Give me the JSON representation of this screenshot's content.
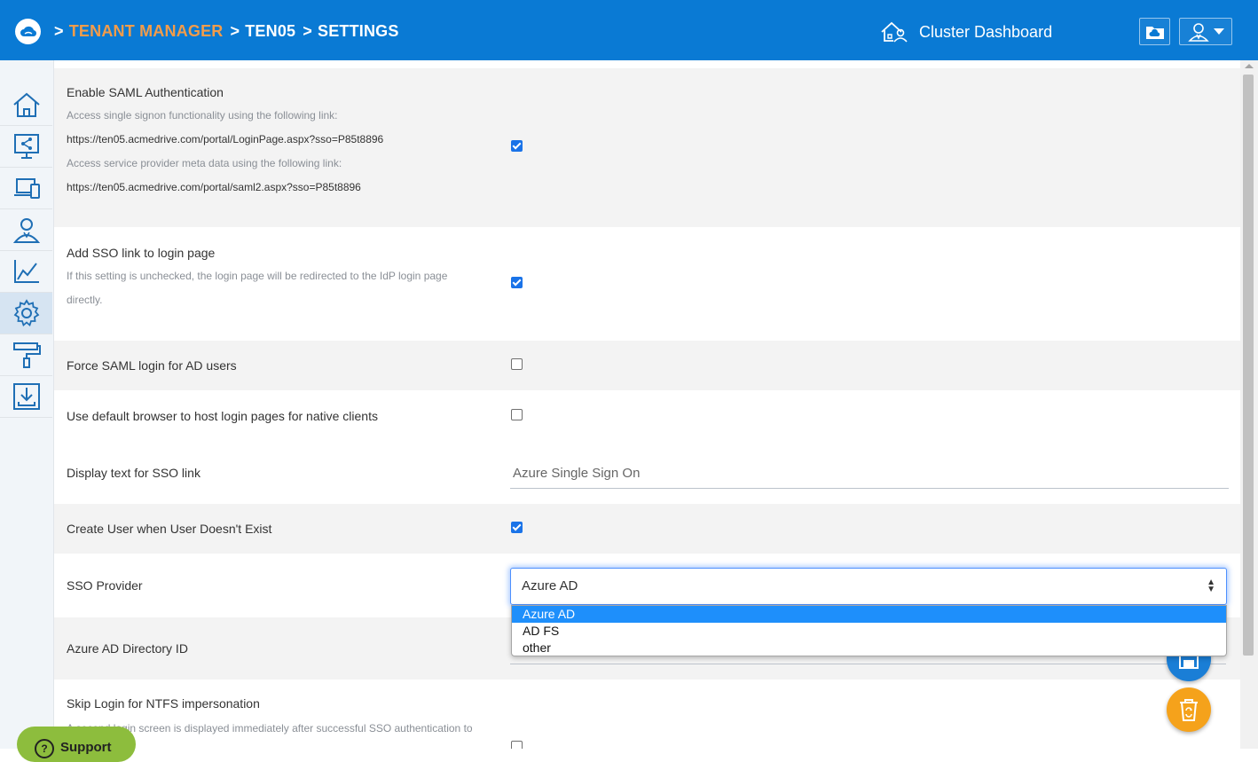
{
  "header": {
    "breadcrumb": [
      {
        "label": "TENANT MANAGER",
        "active": true
      },
      {
        "label": "TEN05",
        "active": false
      },
      {
        "label": "SETTINGS",
        "active": false
      }
    ],
    "breadcrumb_separator": ">",
    "cluster_label": "Cluster Dashboard",
    "accent_color": "#0a7ad4",
    "active_crumb_color": "#f39c4a"
  },
  "sidebar": {
    "items": [
      {
        "icon": "home-icon"
      },
      {
        "icon": "share-screen-icon"
      },
      {
        "icon": "devices-icon"
      },
      {
        "icon": "user-admin-icon"
      },
      {
        "icon": "chart-icon"
      },
      {
        "icon": "gear-icon",
        "active": true
      },
      {
        "icon": "paint-roller-icon"
      },
      {
        "icon": "download-icon"
      }
    ]
  },
  "settings": {
    "saml": {
      "label": "Enable SAML Authentication",
      "desc1": "Access single signon functionality using the following link:",
      "link1": "https://ten05.acmedrive.com/portal/LoginPage.aspx?sso=P85t8896",
      "desc2": "Access service provider meta data using the following link:",
      "link2": "https://ten05.acmedrive.com/portal/saml2.aspx?sso=P85t8896",
      "checked": true
    },
    "sso_link": {
      "label": "Add SSO link to login page",
      "desc": "If this setting is unchecked, the login page will be redirected to the IdP login page directly.",
      "checked": true
    },
    "force_saml": {
      "label": "Force SAML login for AD users",
      "checked": false
    },
    "default_browser": {
      "label": "Use default browser to host login pages for native clients",
      "checked": false
    },
    "display_text": {
      "label": "Display text for SSO link",
      "value": "Azure Single Sign On"
    },
    "create_user": {
      "label": "Create User when User Doesn't Exist",
      "checked": true
    },
    "sso_provider": {
      "label": "SSO Provider",
      "value": "Azure AD",
      "options": [
        "Azure AD",
        "AD FS",
        "other"
      ]
    },
    "directory_id": {
      "label": "Azure AD Directory ID"
    },
    "skip_login": {
      "label": "Skip Login for NTFS impersonation",
      "desc": "A second login screen is displayed immediately after successful SSO authentication to"
    }
  },
  "support": {
    "label": "Support"
  }
}
